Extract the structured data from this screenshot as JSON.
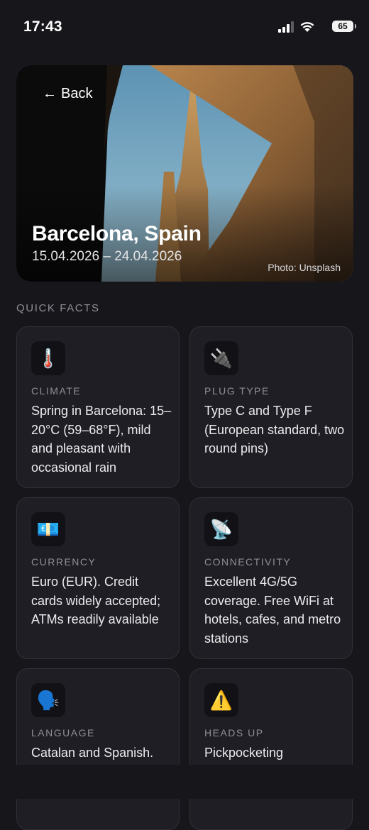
{
  "status_bar": {
    "time": "17:43",
    "battery": "65",
    "icons": [
      "signal-icon",
      "wifi-icon",
      "battery-icon"
    ]
  },
  "hero": {
    "back_label": "Back",
    "back_icon": "arrow-left-icon",
    "title": "Barcelona, Spain",
    "dates": "15.04.2026 – 24.04.2026",
    "photo_credit": "Photo: Unsplash"
  },
  "section": {
    "label": "QUICK FACTS"
  },
  "cards": [
    {
      "icon": "🌡️",
      "icon_name": "thermometer-icon",
      "label": "CLIMATE",
      "text": "Spring in Barcelona: 15–20°C (59–68°F), mild and pleasant with occasional rain"
    },
    {
      "icon": "🔌",
      "icon_name": "plug-icon",
      "label": "PLUG TYPE",
      "text": "Type C and Type F (European standard, two round pins)"
    },
    {
      "icon": "💶",
      "icon_name": "euro-banknote-icon",
      "label": "CURRENCY",
      "text": "Euro (EUR). Credit cards widely accepted; ATMs readily available"
    },
    {
      "icon": "📡",
      "icon_name": "satellite-dish-icon",
      "label": "CONNECTIVITY",
      "text": "Excellent 4G/5G coverage. Free WiFi at hotels, cafes, and metro stations"
    },
    {
      "icon": "🗣️",
      "icon_name": "speaking-head-icon",
      "label": "LANGUAGE",
      "text": "Catalan and Spanish."
    },
    {
      "icon": "⚠️",
      "icon_name": "warning-icon",
      "label": "HEADS UP",
      "text": "Pickpocketing"
    }
  ],
  "colors": {
    "background": "#16161b",
    "card": "#1e1e24",
    "card_border": "#303038",
    "muted_label": "#8e8e95"
  }
}
